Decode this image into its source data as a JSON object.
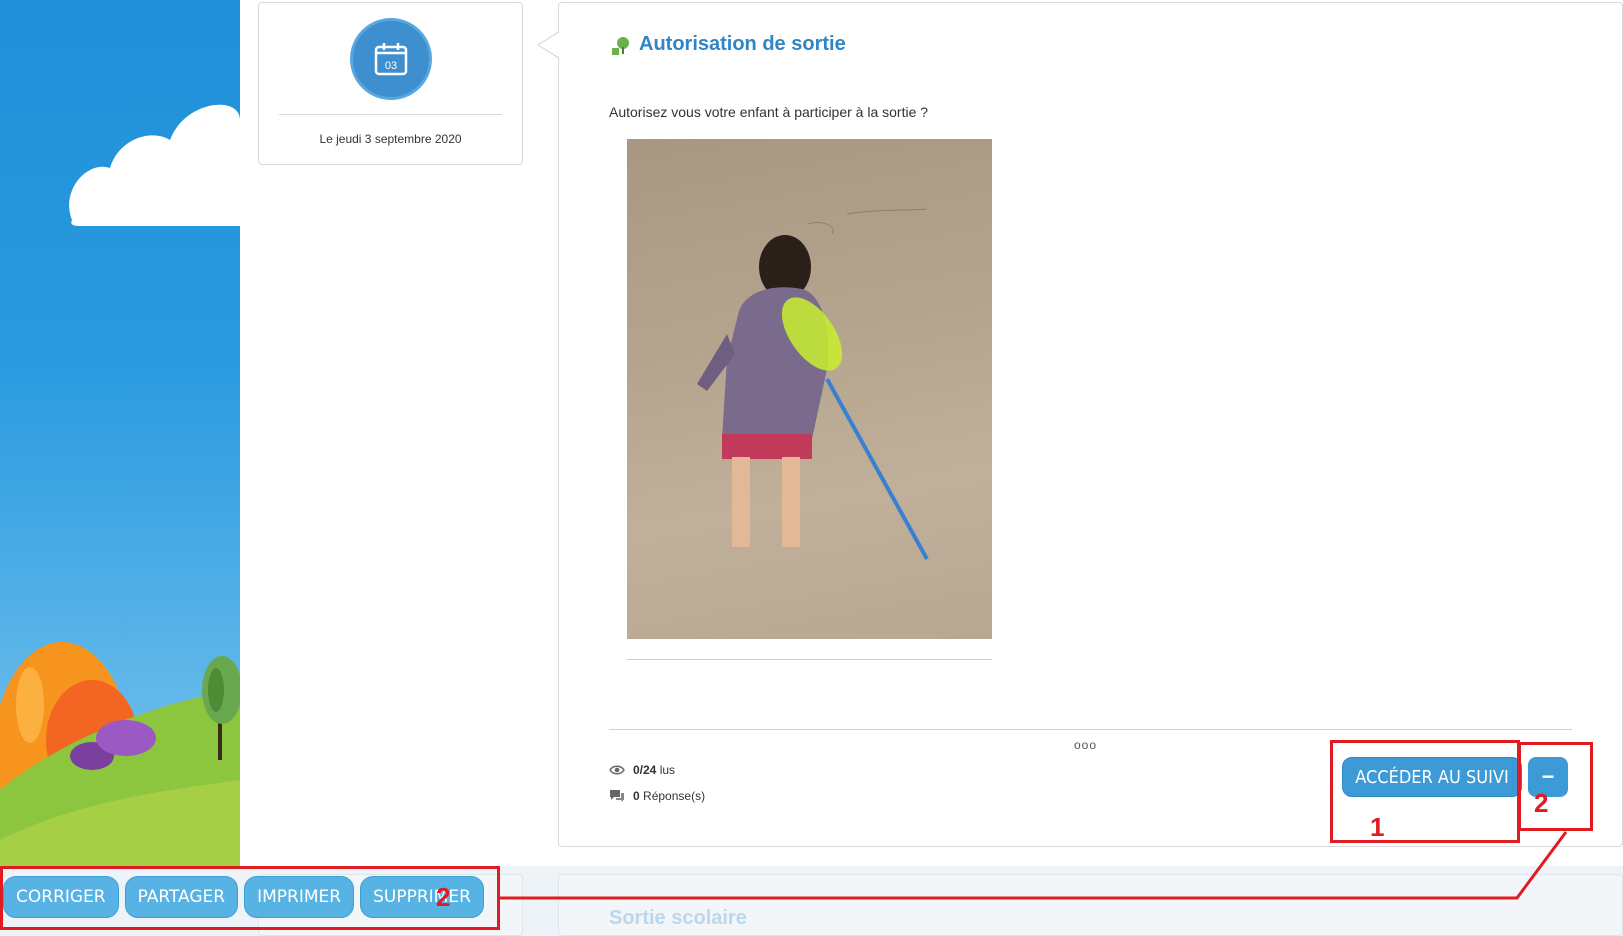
{
  "date_card": {
    "day_number": "03",
    "date_text": "Le jeudi 3 septembre 2020"
  },
  "post": {
    "title": "Autorisation de sortie",
    "question": "Autorisez vous votre enfant à participer à la sortie ?",
    "more_indicator": "ooo",
    "views_count": "0/24",
    "views_label": "lus",
    "replies_count": "0",
    "replies_label": "Réponse(s)",
    "follow_button": "ACCÉDER AU SUIVI",
    "collapse_button": "−"
  },
  "next_post": {
    "title": "Sortie scolaire"
  },
  "action_bar": {
    "buttons": [
      "CORRIGER",
      "PARTAGER",
      "IMPRIMER",
      "SUPPRIMER"
    ]
  },
  "annotations": {
    "label_1": "1",
    "label_2_right": "2",
    "label_2_bar": "2",
    "color": "#e11b22"
  },
  "colors": {
    "accent": "#2f86c6",
    "button": "#3c9ad6",
    "action_button": "#56b3e3"
  }
}
